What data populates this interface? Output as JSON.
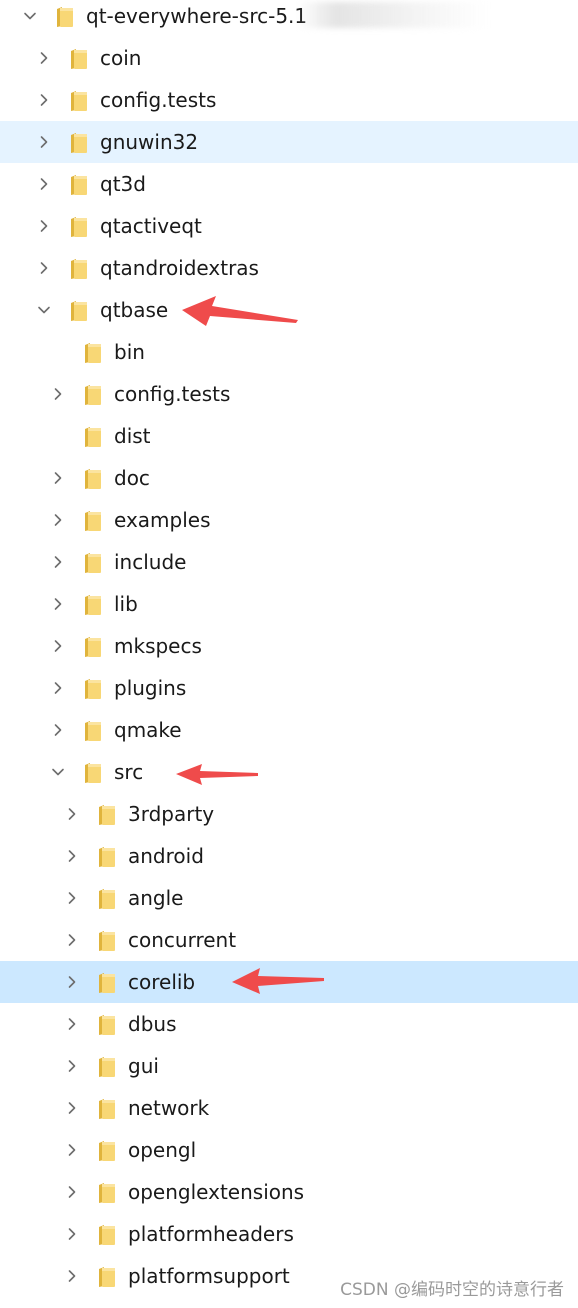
{
  "tree": {
    "items": [
      {
        "label": "qt-everywhere-src-5.1",
        "depth": 0,
        "expander": "expanded",
        "state": "normal"
      },
      {
        "label": "coin",
        "depth": 1,
        "expander": "collapsed",
        "state": "normal"
      },
      {
        "label": "config.tests",
        "depth": 1,
        "expander": "collapsed",
        "state": "normal"
      },
      {
        "label": "gnuwin32",
        "depth": 1,
        "expander": "collapsed",
        "state": "hover"
      },
      {
        "label": "qt3d",
        "depth": 1,
        "expander": "collapsed",
        "state": "normal"
      },
      {
        "label": "qtactiveqt",
        "depth": 1,
        "expander": "collapsed",
        "state": "normal"
      },
      {
        "label": "qtandroidextras",
        "depth": 1,
        "expander": "collapsed",
        "state": "normal"
      },
      {
        "label": "qtbase",
        "depth": 1,
        "expander": "expanded",
        "state": "normal",
        "annotated": true
      },
      {
        "label": "bin",
        "depth": 2,
        "expander": "none",
        "state": "normal"
      },
      {
        "label": "config.tests",
        "depth": 2,
        "expander": "collapsed",
        "state": "normal"
      },
      {
        "label": "dist",
        "depth": 2,
        "expander": "none",
        "state": "normal"
      },
      {
        "label": "doc",
        "depth": 2,
        "expander": "collapsed",
        "state": "normal"
      },
      {
        "label": "examples",
        "depth": 2,
        "expander": "collapsed",
        "state": "normal"
      },
      {
        "label": "include",
        "depth": 2,
        "expander": "collapsed",
        "state": "normal"
      },
      {
        "label": "lib",
        "depth": 2,
        "expander": "collapsed",
        "state": "normal"
      },
      {
        "label": "mkspecs",
        "depth": 2,
        "expander": "collapsed",
        "state": "normal"
      },
      {
        "label": "plugins",
        "depth": 2,
        "expander": "collapsed",
        "state": "normal"
      },
      {
        "label": "qmake",
        "depth": 2,
        "expander": "collapsed",
        "state": "normal"
      },
      {
        "label": "src",
        "depth": 2,
        "expander": "expanded",
        "state": "normal",
        "annotated": true
      },
      {
        "label": "3rdparty",
        "depth": 3,
        "expander": "collapsed",
        "state": "normal"
      },
      {
        "label": "android",
        "depth": 3,
        "expander": "collapsed",
        "state": "normal"
      },
      {
        "label": "angle",
        "depth": 3,
        "expander": "collapsed",
        "state": "normal"
      },
      {
        "label": "concurrent",
        "depth": 3,
        "expander": "collapsed",
        "state": "normal"
      },
      {
        "label": "corelib",
        "depth": 3,
        "expander": "collapsed",
        "state": "selected",
        "annotated": true
      },
      {
        "label": "dbus",
        "depth": 3,
        "expander": "collapsed",
        "state": "normal"
      },
      {
        "label": "gui",
        "depth": 3,
        "expander": "collapsed",
        "state": "normal"
      },
      {
        "label": "network",
        "depth": 3,
        "expander": "collapsed",
        "state": "normal"
      },
      {
        "label": "opengl",
        "depth": 3,
        "expander": "collapsed",
        "state": "normal"
      },
      {
        "label": "openglextensions",
        "depth": 3,
        "expander": "collapsed",
        "state": "normal"
      },
      {
        "label": "platformheaders",
        "depth": 3,
        "expander": "collapsed",
        "state": "normal"
      },
      {
        "label": "platformsupport",
        "depth": 3,
        "expander": "collapsed",
        "state": "normal"
      },
      {
        "label": "",
        "depth": 3,
        "expander": "collapsed",
        "state": "normal"
      }
    ]
  },
  "icons": {
    "folder": "folder-icon",
    "expanded": "chevron-down-icon",
    "collapsed": "chevron-right-icon",
    "annotation": "red-arrow-icon"
  },
  "colors": {
    "hover_bg": "#e5f3ff",
    "selected_bg": "#cce8ff",
    "folder_yellow": "#f8d775",
    "folder_dark": "#e0b43c",
    "chevron": "#6d6d6d",
    "arrow_red": "#ef4b4b"
  },
  "watermark": "CSDN @编码时空的诗意行者"
}
